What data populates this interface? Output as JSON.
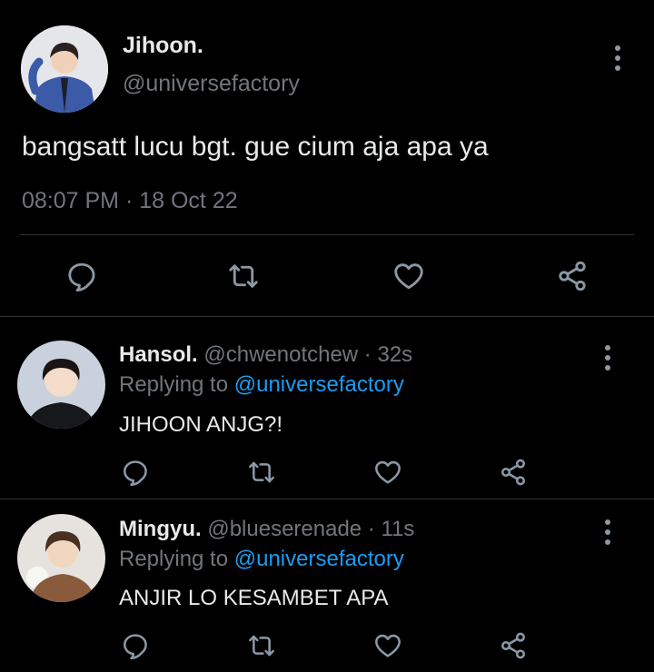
{
  "main_tweet": {
    "display_name": "Jihoon.",
    "handle": "@universefactory",
    "text": "bangsatt lucu bgt. gue cium aja apa ya",
    "timestamp": "08:07 PM · 18 Oct 22"
  },
  "replies": [
    {
      "display_name": "Hansol.",
      "meta": "@chwenotchew · 32s",
      "replying_prefix": "Replying to",
      "replying_handle": "@universefactory",
      "text": "JIHOON ANJG?!"
    },
    {
      "display_name": "Mingyu.",
      "meta": "@blueserenade · 11s",
      "replying_prefix": "Replying to",
      "replying_handle": "@universefactory",
      "text": "ANJIR LO KESAMBET APA"
    }
  ],
  "colors": {
    "background": "#000000",
    "text": "#e7e9ea",
    "muted": "#71767b",
    "link": "#1d9bf0",
    "icon": "#8b98a5",
    "divider": "#2f3336"
  },
  "icons": [
    "reply-icon",
    "retweet-icon",
    "like-icon",
    "share-icon",
    "more-icon"
  ]
}
